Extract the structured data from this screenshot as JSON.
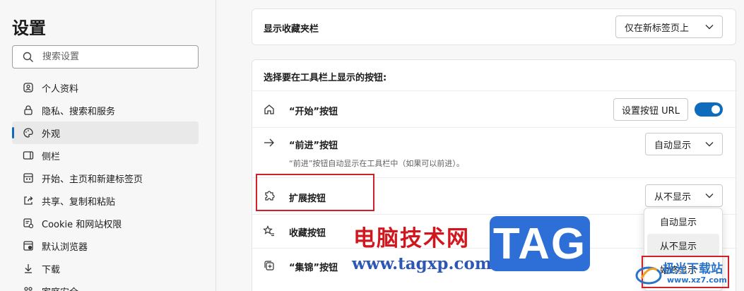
{
  "sidebar": {
    "title": "设置",
    "search_placeholder": "搜索设置",
    "items": [
      {
        "label": "个人资料",
        "icon": "profile-icon"
      },
      {
        "label": "隐私、搜索和服务",
        "icon": "lock-icon"
      },
      {
        "label": "外观",
        "icon": "palette-icon",
        "active": true
      },
      {
        "label": "侧栏",
        "icon": "sidebar-icon"
      },
      {
        "label": "开始、主页和新建标签页",
        "icon": "home-grid-icon"
      },
      {
        "label": "共享、复制和粘贴",
        "icon": "share-icon"
      },
      {
        "label": "Cookie 和网站权限",
        "icon": "site-permissions-icon"
      },
      {
        "label": "默认浏览器",
        "icon": "browser-icon"
      },
      {
        "label": "下载",
        "icon": "download-icon"
      },
      {
        "label": "家庭安全",
        "icon": "family-icon"
      }
    ]
  },
  "favorites_bar": {
    "label": "显示收藏夹栏",
    "value": "仅在新标签页上"
  },
  "toolbar_section": {
    "heading": "选择要在工具栏上显示的按钮:",
    "rows": [
      {
        "label": "“开始”按钮",
        "button": "设置按钮 URL",
        "toggle_on": true
      },
      {
        "label": "“前进”按钮",
        "value": "自动显示",
        "description": "“前进”按钮自动显示在工具栏中（如果可以前进）。"
      },
      {
        "label": "扩展按钮",
        "value": "从不显示"
      },
      {
        "label": "收藏按钮"
      },
      {
        "label": "“集锦”按钮"
      }
    ]
  },
  "menu": {
    "options": [
      "自动显示",
      "从不显示",
      "始终显示"
    ],
    "hovered_index": 1
  },
  "watermark": {
    "site_cn": "电脑技术网",
    "site_url": "www.tagxp.com",
    "tag": "TAG",
    "xz_cn": "极光下载站",
    "xz_url": "www.xz7.com"
  },
  "colors": {
    "accent": "#0f6cbd",
    "annotation_red": "#d0202a"
  }
}
